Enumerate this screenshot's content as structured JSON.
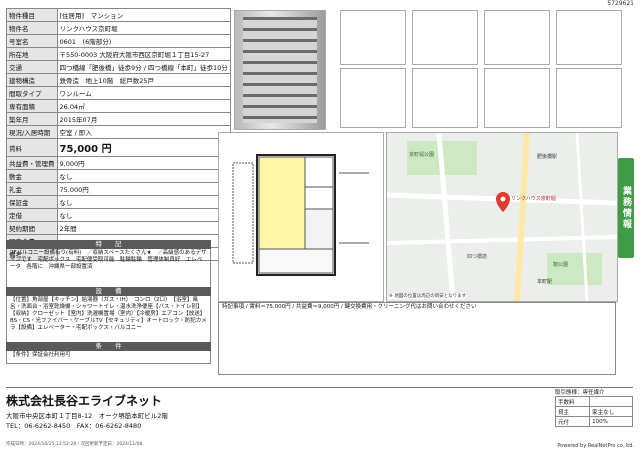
{
  "doc_id": "5729621",
  "spec": {
    "rows": [
      [
        "物件種目",
        "[住居用]　マンション"
      ],
      [
        "物件名",
        "リンクハウス京町堀"
      ],
      [
        "号室名",
        "0601　(6階部分)"
      ],
      [
        "所在地",
        "〒550-0003 大阪府大阪市西区京町堀１丁目15-27"
      ],
      [
        "交通",
        "四つ橋線「肥後橋」徒歩9分 / 四つ橋線「本町」徒歩10分"
      ],
      [
        "建物構造",
        "鉄骨造　地上10階　総戸数25戸"
      ],
      [
        "間取タイプ",
        "ワンルーム"
      ],
      [
        "専有面積",
        "26.04㎡"
      ],
      [
        "築年月",
        "2015年07月"
      ],
      [
        "現況/入居時期",
        "空室 / 即入"
      ],
      [
        "賃料",
        "75,000 円"
      ],
      [
        "共益費・管理費",
        "9,000円"
      ],
      [
        "敷金",
        "なし"
      ],
      [
        "礼金",
        "75,000円"
      ],
      [
        "保証金",
        "なし"
      ],
      [
        "定借",
        "なし"
      ],
      [
        "契約期間",
        "2年間"
      ],
      [
        "町内会費",
        ""
      ],
      [
        "備考",
        ""
      ]
    ],
    "shokyaku_label": "償却・敷引",
    "shokyaku_value": "なし",
    "direction_label": "バルコニー方位",
    "direction_value": "西北",
    "keiyaku_label": "更新料",
    "keiyaku_value": "なし"
  },
  "tokki": {
    "header": "特　　記",
    "text": "2Fバルコニー設備有り(有料)　／収納スペースたくさん★　／高級感のあるデザインです　宅配ボックス　宅配便受取可能　駐輪駐輪　管理体制良好　エレベータ　各階に　沖縄県一部設置済"
  },
  "setsubi": {
    "header": "設　　備",
    "text": "【位置】角部屋【キッチン】給湯器（ガス・IH）　コンロ（2口）　【浴室】風呂・洗面台・浴室乾燥機・シャワートイレ・温水洗浄便座【バス・トイレ別】【収納】クローゼット【室内】洗濯機置場（室内）【冷暖房】エアコン【放送】BS・CS・光ファイバー・ケーブルTV【セキュリティ】オートロック・防犯カメラ【設備】エレベーター・宅配ボックス・バルコニー"
  },
  "jouken": {
    "header": "条　　件",
    "text": "【条件】保証会社利用可"
  },
  "info": {
    "text": "特記事項 / 賃料＝75,000円 / 共益費＝9,000円 / 鍵交換費用・クリーニング代はお問い合わせください"
  },
  "map_text": "※ 地図の位置は周辺の目安となります",
  "map_labels": [
    "京町堀公園",
    "リンクハウス京町堀",
    "肥後橋駅",
    "本町駅",
    "四つ橋筋",
    "靭公園"
  ],
  "side_button": "業務情報",
  "company": {
    "name": "株式会社長谷エライブネット",
    "address": "大阪市中央区本町１丁目8-12　オーク堺筋本町ビル2階",
    "contact": "TEL：06-6262-8450　FAX：06-6262-8480",
    "updated": "作成日時：2024/10/25 13:52:28 / 次回更新予定日：2024/11/08"
  },
  "fee": {
    "title": "取引態様：専任媒介",
    "rows": [
      [
        "手数料",
        ""
      ],
      [
        "貸主",
        "家主なし"
      ],
      [
        "元付",
        "100%"
      ]
    ]
  },
  "footer": "Powered by RealNetPro co.,ltd."
}
